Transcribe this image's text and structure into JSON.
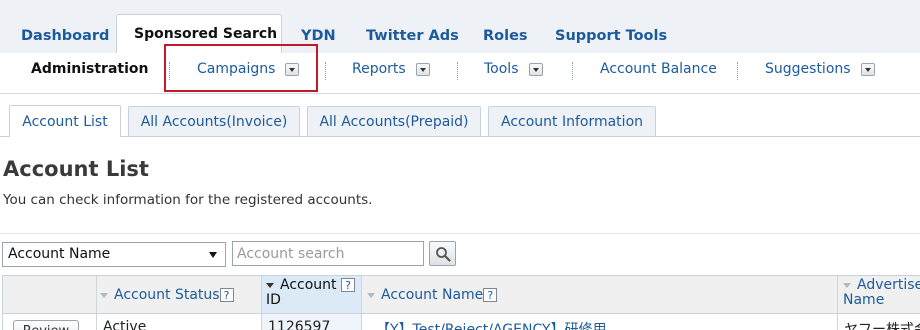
{
  "top_tabs": {
    "dashboard": "Dashboard",
    "sponsored_search": "Sponsored Search",
    "ydn": "YDN",
    "twitter_ads": "Twitter Ads",
    "roles": "Roles",
    "support_tools": "Support Tools"
  },
  "subnav": {
    "administration": "Administration",
    "campaigns": "Campaigns",
    "reports": "Reports",
    "tools": "Tools",
    "account_balance": "Account Balance",
    "suggestions": "Suggestions"
  },
  "account_tabs": {
    "account_list": "Account List",
    "all_invoice": "All Accounts(Invoice)",
    "all_prepaid": "All Accounts(Prepaid)",
    "account_information": "Account Information"
  },
  "page": {
    "title": "Account List",
    "description": "You can check information for the registered accounts."
  },
  "search": {
    "field_selected": "Account Name",
    "placeholder": "Account search"
  },
  "table": {
    "headers": {
      "account_status": "Account Status",
      "account_id_1": "Account",
      "account_id_2": "ID",
      "account_name": "Account Name",
      "advertiser_1": "Advertise",
      "advertiser_2": "Name",
      "help": "?"
    },
    "rows": [
      {
        "action": "Review",
        "status": "Active",
        "account_id": "1126597",
        "account_name": "【Y】Test/Reject/AGENCY】研修用",
        "advertiser": "ヤフー株式会"
      }
    ]
  },
  "colors": {
    "link": "#1d5a9c",
    "highlight_border": "#c0192b",
    "tab_bg": "#eef2f6"
  }
}
